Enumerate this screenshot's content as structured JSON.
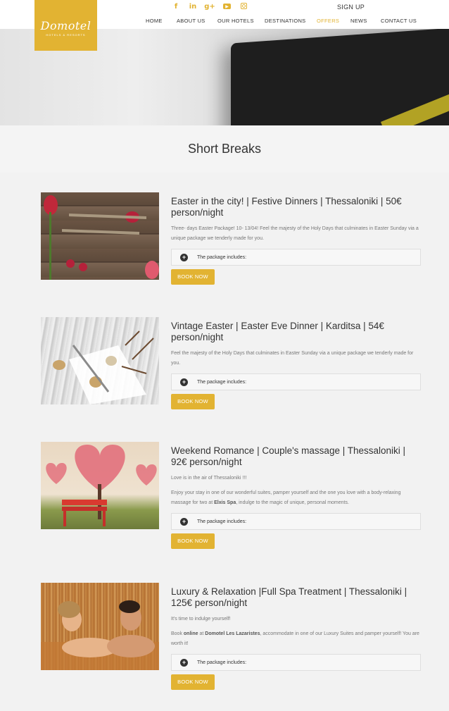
{
  "brand": {
    "logo_text": "Domotel",
    "logo_sub": "HOTELS & RESORTS",
    "accent": "#e2b332"
  },
  "header": {
    "signup": "SIGN UP",
    "social": [
      "facebook-icon",
      "linkedin-icon",
      "google-plus-icon",
      "youtube-icon",
      "instagram-icon"
    ],
    "nav": [
      "HOME",
      "ABOUT US",
      "OUR HOTELS",
      "DESTINATIONS",
      "OFFERS",
      "NEWS",
      "CONTACT US"
    ],
    "active_nav": "OFFERS"
  },
  "page": {
    "title": "Short Breaks"
  },
  "offers": [
    {
      "title": "Easter in the city! | Festive Dinners | Thessaloniki | 50€ person/night",
      "paragraphs": [
        "Three- days Easter Package! 10- 13/04! Feel the majesty of the Holy Days that culminates in Easter Sunday via a unique package we tenderly made for you."
      ],
      "package_label": "The package includes:",
      "button": "BOOK NOW"
    },
    {
      "title": "Vintage Easter | Easter Eve Dinner | Karditsa | 54€ person/night",
      "paragraphs": [
        "Feel the majesty of the Holy Days that culminates in Easter Sunday via a unique package we tenderly made for you."
      ],
      "package_label": "The package includes:",
      "button": "BOOK NOW"
    },
    {
      "title": "Weekend Romance | Couple's massage | Thessaloniki | 92€ person/night",
      "paragraphs": [
        "Love is in the air of Thessaloniki !!!",
        "Enjoy your stay in one of our wonderful suites, pamper yourself and the one you love with a body-relaxing massage for two at ",
        "Elxis Spa",
        ", indulge to the magic of unique, personal moments."
      ],
      "package_label": "The package includes:",
      "button": "BOOK NOW"
    },
    {
      "title": "Luxury & Relaxation |Full Spa Treatment | Thessaloniki | 125€ person/night",
      "paragraphs": [
        "It's time to indulge yourself!",
        "Book ",
        "online",
        " at ",
        "Domotel Les Lazaristes",
        ", accommodate in one of our Luxury Suites and pamper yourself! You are worth it!"
      ],
      "package_label": "The package includes:",
      "button": "BOOK NOW"
    }
  ]
}
